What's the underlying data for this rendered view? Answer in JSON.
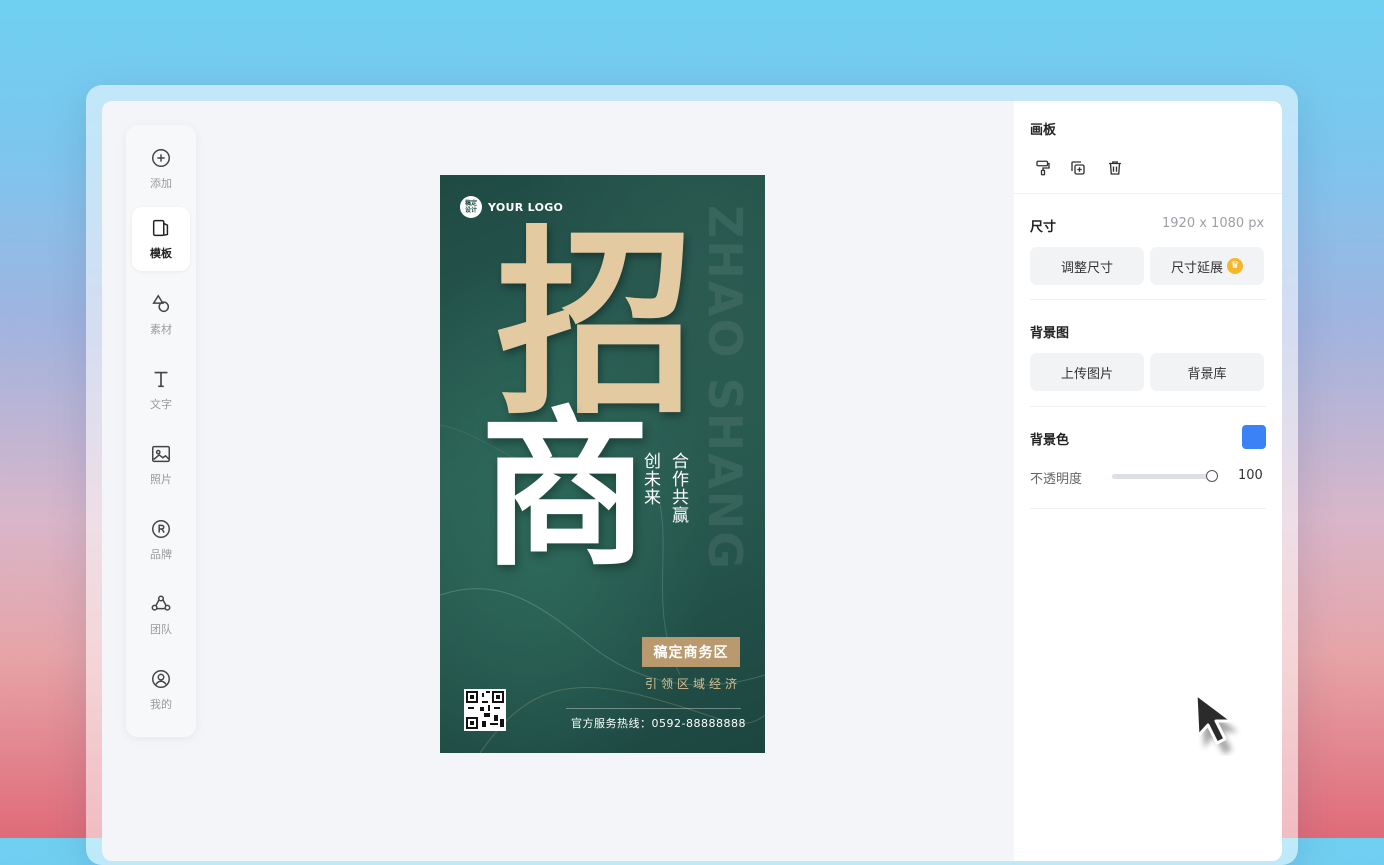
{
  "toolbar": {
    "items": [
      {
        "label": "添加",
        "icon": "plus-circle-icon"
      },
      {
        "label": "模板",
        "icon": "template-icon",
        "active": true
      },
      {
        "label": "素材",
        "icon": "shapes-icon"
      },
      {
        "label": "文字",
        "icon": "text-icon"
      },
      {
        "label": "照片",
        "icon": "image-icon"
      },
      {
        "label": "品牌",
        "icon": "registered-icon"
      },
      {
        "label": "团队",
        "icon": "team-icon"
      },
      {
        "label": "我的",
        "icon": "user-icon"
      }
    ]
  },
  "poster": {
    "logo_badge": "稿定\n设计",
    "logo_text": "YOUR LOGO",
    "vertical_en": "ZHAO SHANG",
    "char1": "招",
    "char2": "商",
    "slogan1": "合作共赢",
    "slogan2": "创未来",
    "biz_tag": "稿定商务区",
    "lead_line": "引领区域经济",
    "hotline": "官方服务热线：0592-88888888"
  },
  "panel": {
    "artboard_title": "画板",
    "size_title": "尺寸",
    "size_value": "1920 x 1080 px",
    "resize_button": "调整尺寸",
    "extend_button": "尺寸延展",
    "bg_image_title": "背景图",
    "upload_button": "上传图片",
    "bg_library_button": "背景库",
    "bg_color_title": "背景色",
    "bg_color": "#3b82f6",
    "opacity_label": "不透明度",
    "opacity_value": "100",
    "opacity_level": 1.0
  },
  "colors": {
    "poster_gold": "#e4caa0",
    "poster_green": "#1f4a44",
    "tag_gold": "#b89a6e"
  }
}
